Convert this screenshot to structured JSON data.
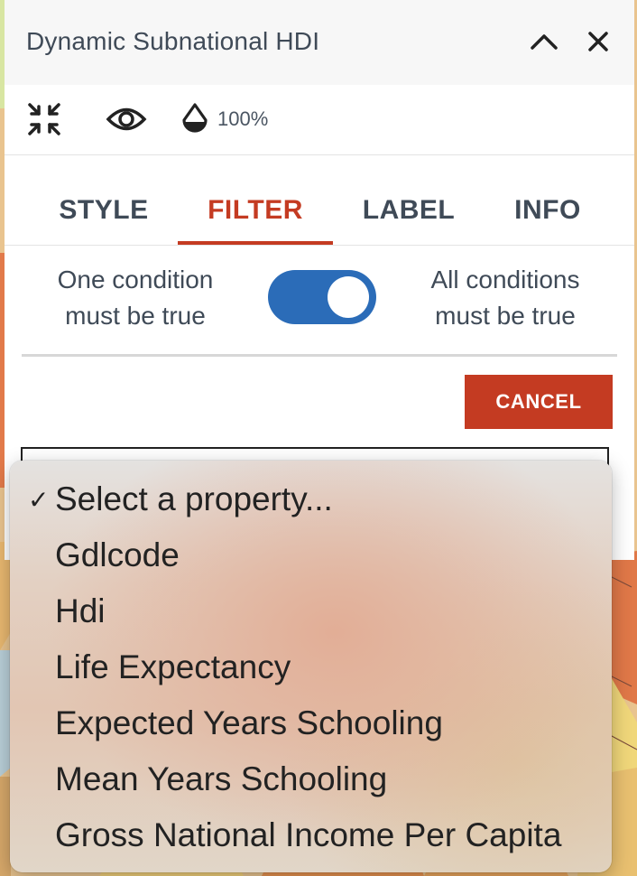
{
  "panel": {
    "title": "Dynamic Subnational HDI",
    "toolbar": {
      "opacity_value": "100%",
      "icons": [
        "shrink-icon",
        "eye-icon",
        "opacity-drop-icon"
      ]
    },
    "header_icons": [
      "chevron-up-icon",
      "close-icon"
    ],
    "tabs": [
      {
        "label": "STYLE",
        "active": false
      },
      {
        "label": "FILTER",
        "active": true
      },
      {
        "label": "LABEL",
        "active": false
      },
      {
        "label": "INFO",
        "active": false
      }
    ],
    "conditions": {
      "any_label_line1": "One condition",
      "any_label_line2": "must be true",
      "all_label_line1": "All conditions",
      "all_label_line2": "must be true",
      "toggle_on": true
    },
    "cancel_label": "CANCEL",
    "accent_color": "#c43b22",
    "toggle_color": "#2b6cb8"
  },
  "dropdown": {
    "selected": "Select a property...",
    "options": [
      "Select a property...",
      "Gdlcode",
      "Hdi",
      "Life Expectancy",
      "Expected Years Schooling",
      "Mean Years Schooling",
      "Gross National Income Per Capita"
    ]
  }
}
